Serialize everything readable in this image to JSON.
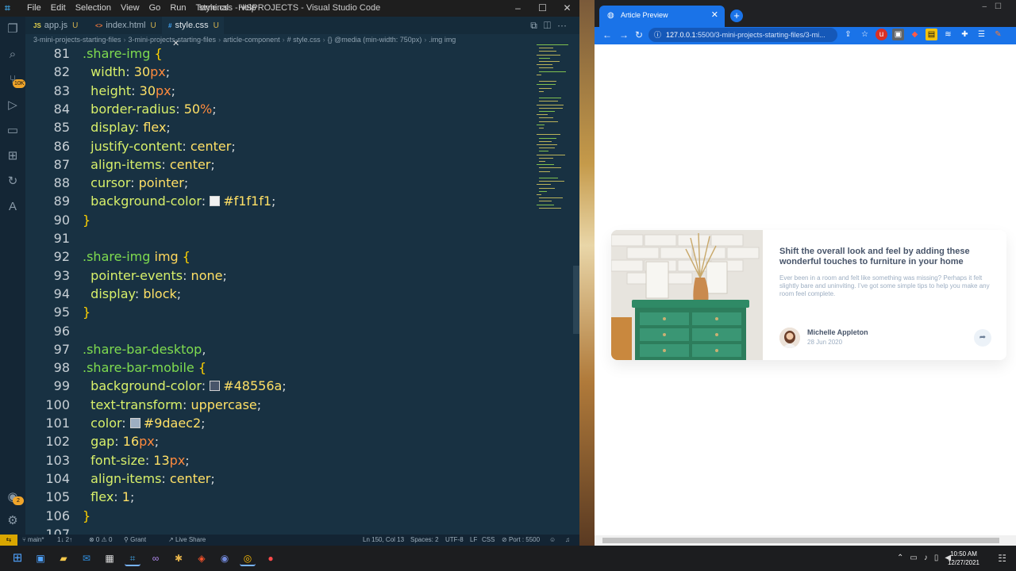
{
  "vscode": {
    "title": "style.css - VSPROJECTS - Visual Studio Code",
    "menu": [
      "File",
      "Edit",
      "Selection",
      "View",
      "Go",
      "Run",
      "Terminal",
      "Help"
    ],
    "window_controls": [
      "–",
      "☐",
      "✕"
    ],
    "activity_badges": {
      "source_control": "10K",
      "accounts": "2"
    },
    "tabs": [
      {
        "icon": "JS",
        "label": "app.js",
        "status": "U",
        "active": false
      },
      {
        "icon": "<>",
        "label": "index.html",
        "status": "U",
        "active": false
      },
      {
        "icon": "#",
        "label": "style.css",
        "status": "U",
        "active": true
      }
    ],
    "breadcrumb": [
      "3-mini-projects-starting-files",
      "3-mini-projects-starting-files",
      "article-component",
      "# style.css",
      "{} @media (min-width: 750px)",
      ".img img"
    ],
    "lines": [
      {
        "n": "81",
        "text": ".share-img {"
      },
      {
        "n": "82",
        "text": "  width: 30px;"
      },
      {
        "n": "83",
        "text": "  height: 30px;"
      },
      {
        "n": "84",
        "text": "  border-radius: 50%;"
      },
      {
        "n": "85",
        "text": "  display: flex;"
      },
      {
        "n": "86",
        "text": "  justify-content: center;"
      },
      {
        "n": "87",
        "text": "  align-items: center;"
      },
      {
        "n": "88",
        "text": "  cursor: pointer;"
      },
      {
        "n": "89",
        "text": "  background-color: #f1f1f1;"
      },
      {
        "n": "90",
        "text": "}"
      },
      {
        "n": "91",
        "text": ""
      },
      {
        "n": "92",
        "text": ".share-img img {"
      },
      {
        "n": "93",
        "text": "  pointer-events: none;"
      },
      {
        "n": "94",
        "text": "  display: block;"
      },
      {
        "n": "95",
        "text": "}"
      },
      {
        "n": "96",
        "text": ""
      },
      {
        "n": "97",
        "text": ".share-bar-desktop,"
      },
      {
        "n": "98",
        "text": ".share-bar-mobile {"
      },
      {
        "n": "99",
        "text": "  background-color: #48556a;"
      },
      {
        "n": "100",
        "text": "  text-transform: uppercase;"
      },
      {
        "n": "101",
        "text": "  color: #9daec2;"
      },
      {
        "n": "102",
        "text": "  gap: 16px;"
      },
      {
        "n": "103",
        "text": "  font-size: 13px;"
      },
      {
        "n": "104",
        "text": "  align-items: center;"
      },
      {
        "n": "105",
        "text": "  flex: 1;"
      },
      {
        "n": "106",
        "text": "}"
      },
      {
        "n": "107",
        "text": ""
      }
    ],
    "swatch_colors": {
      "89": "#f1f1f1",
      "99": "#48556a",
      "101": "#9daec2"
    },
    "status": {
      "branch": "main*",
      "sync": "1↓ 2↑",
      "errors": "⊗ 0 ⚠ 0",
      "grant": "Grant",
      "live_share": "Live Share",
      "cursor": "Ln 150, Col 13",
      "spaces": "Spaces: 2",
      "encoding": "UTF-8",
      "eol": "LF",
      "language": "CSS",
      "port": "Port : 5500"
    }
  },
  "chrome": {
    "tab_title": "Article Preview",
    "url_host": "127.0.0.1",
    "url_path": ":5500/3-mini-projects-starting-files/3-mi...",
    "article": {
      "title": "Shift the overall look and feel by adding these wonderful touches to furniture in your home",
      "description": "Ever been in a room and felt like something was missing? Perhaps it felt slightly bare and uninviting. I’ve got some simple tips to help you make any room feel complete.",
      "author": "Michelle Appleton",
      "date": "28 Jun 2020"
    }
  },
  "taskbar": {
    "time": "10:50 AM",
    "date": "12/27/2021"
  },
  "colors": {
    "editor_bg": "#183142",
    "chrome_accent": "#1a73e8",
    "card_title": "#48556a",
    "card_muted": "#9daec2"
  }
}
